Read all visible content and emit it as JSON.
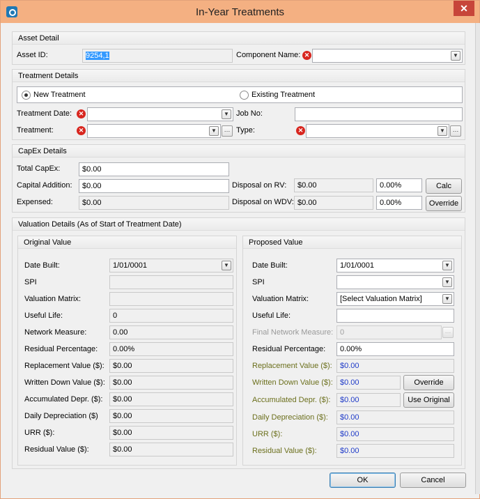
{
  "window": {
    "title": "In-Year Treatments",
    "close_label": "✕"
  },
  "asset_detail": {
    "header": "Asset Detail",
    "asset_id_label": "Asset ID:",
    "asset_id_value": "9254,1",
    "component_name_label": "Component Name:",
    "component_name_value": ""
  },
  "treatment_details": {
    "header": "Treatment Details",
    "new_treatment_label": "New Treatment",
    "existing_treatment_label": "Existing Treatment",
    "selected": "New Treatment",
    "treatment_date_label": "Treatment Date:",
    "treatment_date_value": "",
    "job_no_label": "Job No:",
    "job_no_value": "",
    "treatment_label": "Treatment:",
    "treatment_value": "",
    "type_label": "Type:",
    "type_value": ""
  },
  "capex_details": {
    "header": "CapEx Details",
    "total_capex_label": "Total CapEx:",
    "total_capex_value": "$0.00",
    "capital_addition_label": "Capital Addition:",
    "capital_addition_value": "$0.00",
    "expensed_label": "Expensed:",
    "expensed_value": "$0.00",
    "disposal_rv_label": "Disposal on RV:",
    "disposal_rv_value": "$0.00",
    "disposal_rv_pct": "0.00%",
    "disposal_wdv_label": "Disposal on WDV:",
    "disposal_wdv_value": "$0.00",
    "disposal_wdv_pct": "0.00%",
    "calc_label": "Calc",
    "override_label": "Override"
  },
  "valuation_details": {
    "header": "Valuation Details (As of Start of Treatment Date)",
    "original": {
      "header": "Original Value",
      "date_built_label": "Date Built:",
      "date_built_value": "1/01/0001",
      "spi_label": "SPI",
      "spi_value": "",
      "valuation_matrix_label": "Valuation Matrix:",
      "valuation_matrix_value": "",
      "useful_life_label": "Useful Life:",
      "useful_life_value": "0",
      "network_measure_label": "Network Measure:",
      "network_measure_value": "0.00",
      "residual_pct_label": "Residual Percentage:",
      "residual_pct_value": "0.00%",
      "replacement_value_label": "Replacement Value ($):",
      "replacement_value_value": "$0.00",
      "written_down_label": "Written Down Value ($):",
      "written_down_value": "$0.00",
      "accumulated_depr_label": "Accumulated Depr. ($):",
      "accumulated_depr_value": "$0.00",
      "daily_depr_label": "Daily Depreciation ($)",
      "daily_depr_value": "$0.00",
      "urr_label": "URR ($):",
      "urr_value": "$0.00",
      "residual_value_label": "Residual Value ($):",
      "residual_value_value": "$0.00"
    },
    "proposed": {
      "header": "Proposed Value",
      "date_built_label": "Date Built:",
      "date_built_value": "1/01/0001",
      "spi_label": "SPI",
      "spi_value": "",
      "valuation_matrix_label": "Valuation Matrix:",
      "valuation_matrix_value": "[Select Valuation Matrix]",
      "useful_life_label": "Useful Life:",
      "useful_life_value": "",
      "final_network_label": "Final Network Measure:",
      "final_network_value": "0",
      "residual_pct_label": "Residual Percentage:",
      "residual_pct_value": "0.00%",
      "replacement_value_label": "Replacement Value ($):",
      "replacement_value_value": "$0.00",
      "written_down_label": "Written Down Value ($):",
      "written_down_value": "$0.00",
      "override_label": "Override",
      "accumulated_depr_label": "Accumulated Depr. ($):",
      "accumulated_depr_value": "$0.00",
      "use_original_label": "Use Original",
      "daily_depr_label": "Daily Depreciation  ($):",
      "daily_depr_value": "$0.00",
      "urr_label": "URR ($):",
      "urr_value": "$0.00",
      "residual_value_label": "Residual Value ($):",
      "residual_value_value": "$0.00"
    }
  },
  "footer": {
    "ok_label": "OK",
    "cancel_label": "Cancel"
  },
  "icons": {
    "error": "error-x-icon",
    "dropdown": "chevron-down-icon",
    "ellipsis": "ellipsis-icon"
  }
}
